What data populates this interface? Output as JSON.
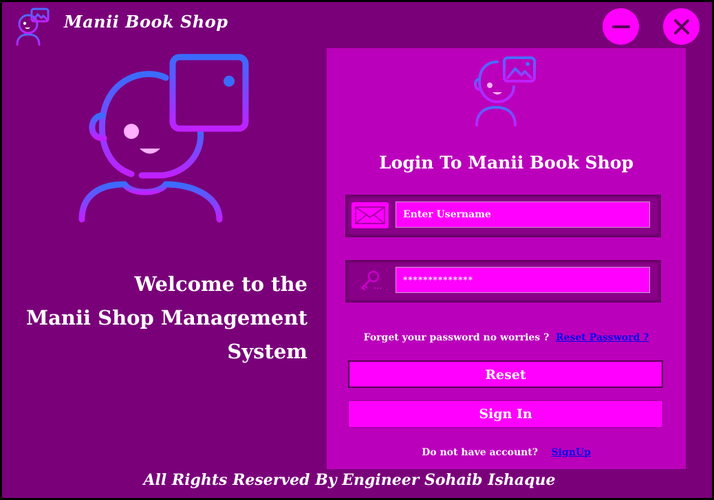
{
  "app": {
    "title": "Manii Book Shop",
    "logo_icon": "robot-avatar-icon",
    "minimize_icon": "minus-icon",
    "close_icon": "close-icon"
  },
  "welcome": {
    "line1": "Welcome to the",
    "line2": "Manii Shop Management",
    "line3": "System"
  },
  "login": {
    "title": "Login To Manii Book Shop",
    "username_placeholder": "Enter Username",
    "username_icon": "mail-icon",
    "password_value": "**************",
    "password_icon": "key-icon",
    "forgot_text": "Forget your password no worries ?",
    "reset_password_link": "Reset Password ?",
    "reset_button": "Reset",
    "signin_button": "Sign In",
    "no_account_text": "Do not have account?",
    "signup_link": "SignUp"
  },
  "footer": {
    "text": "All Rights Reserved By Engineer Sohaib Ishaque"
  },
  "colors": {
    "background": "#7a007a",
    "panel": "#bb00bb",
    "accent": "#ff00ff",
    "link": "#0000ee"
  }
}
